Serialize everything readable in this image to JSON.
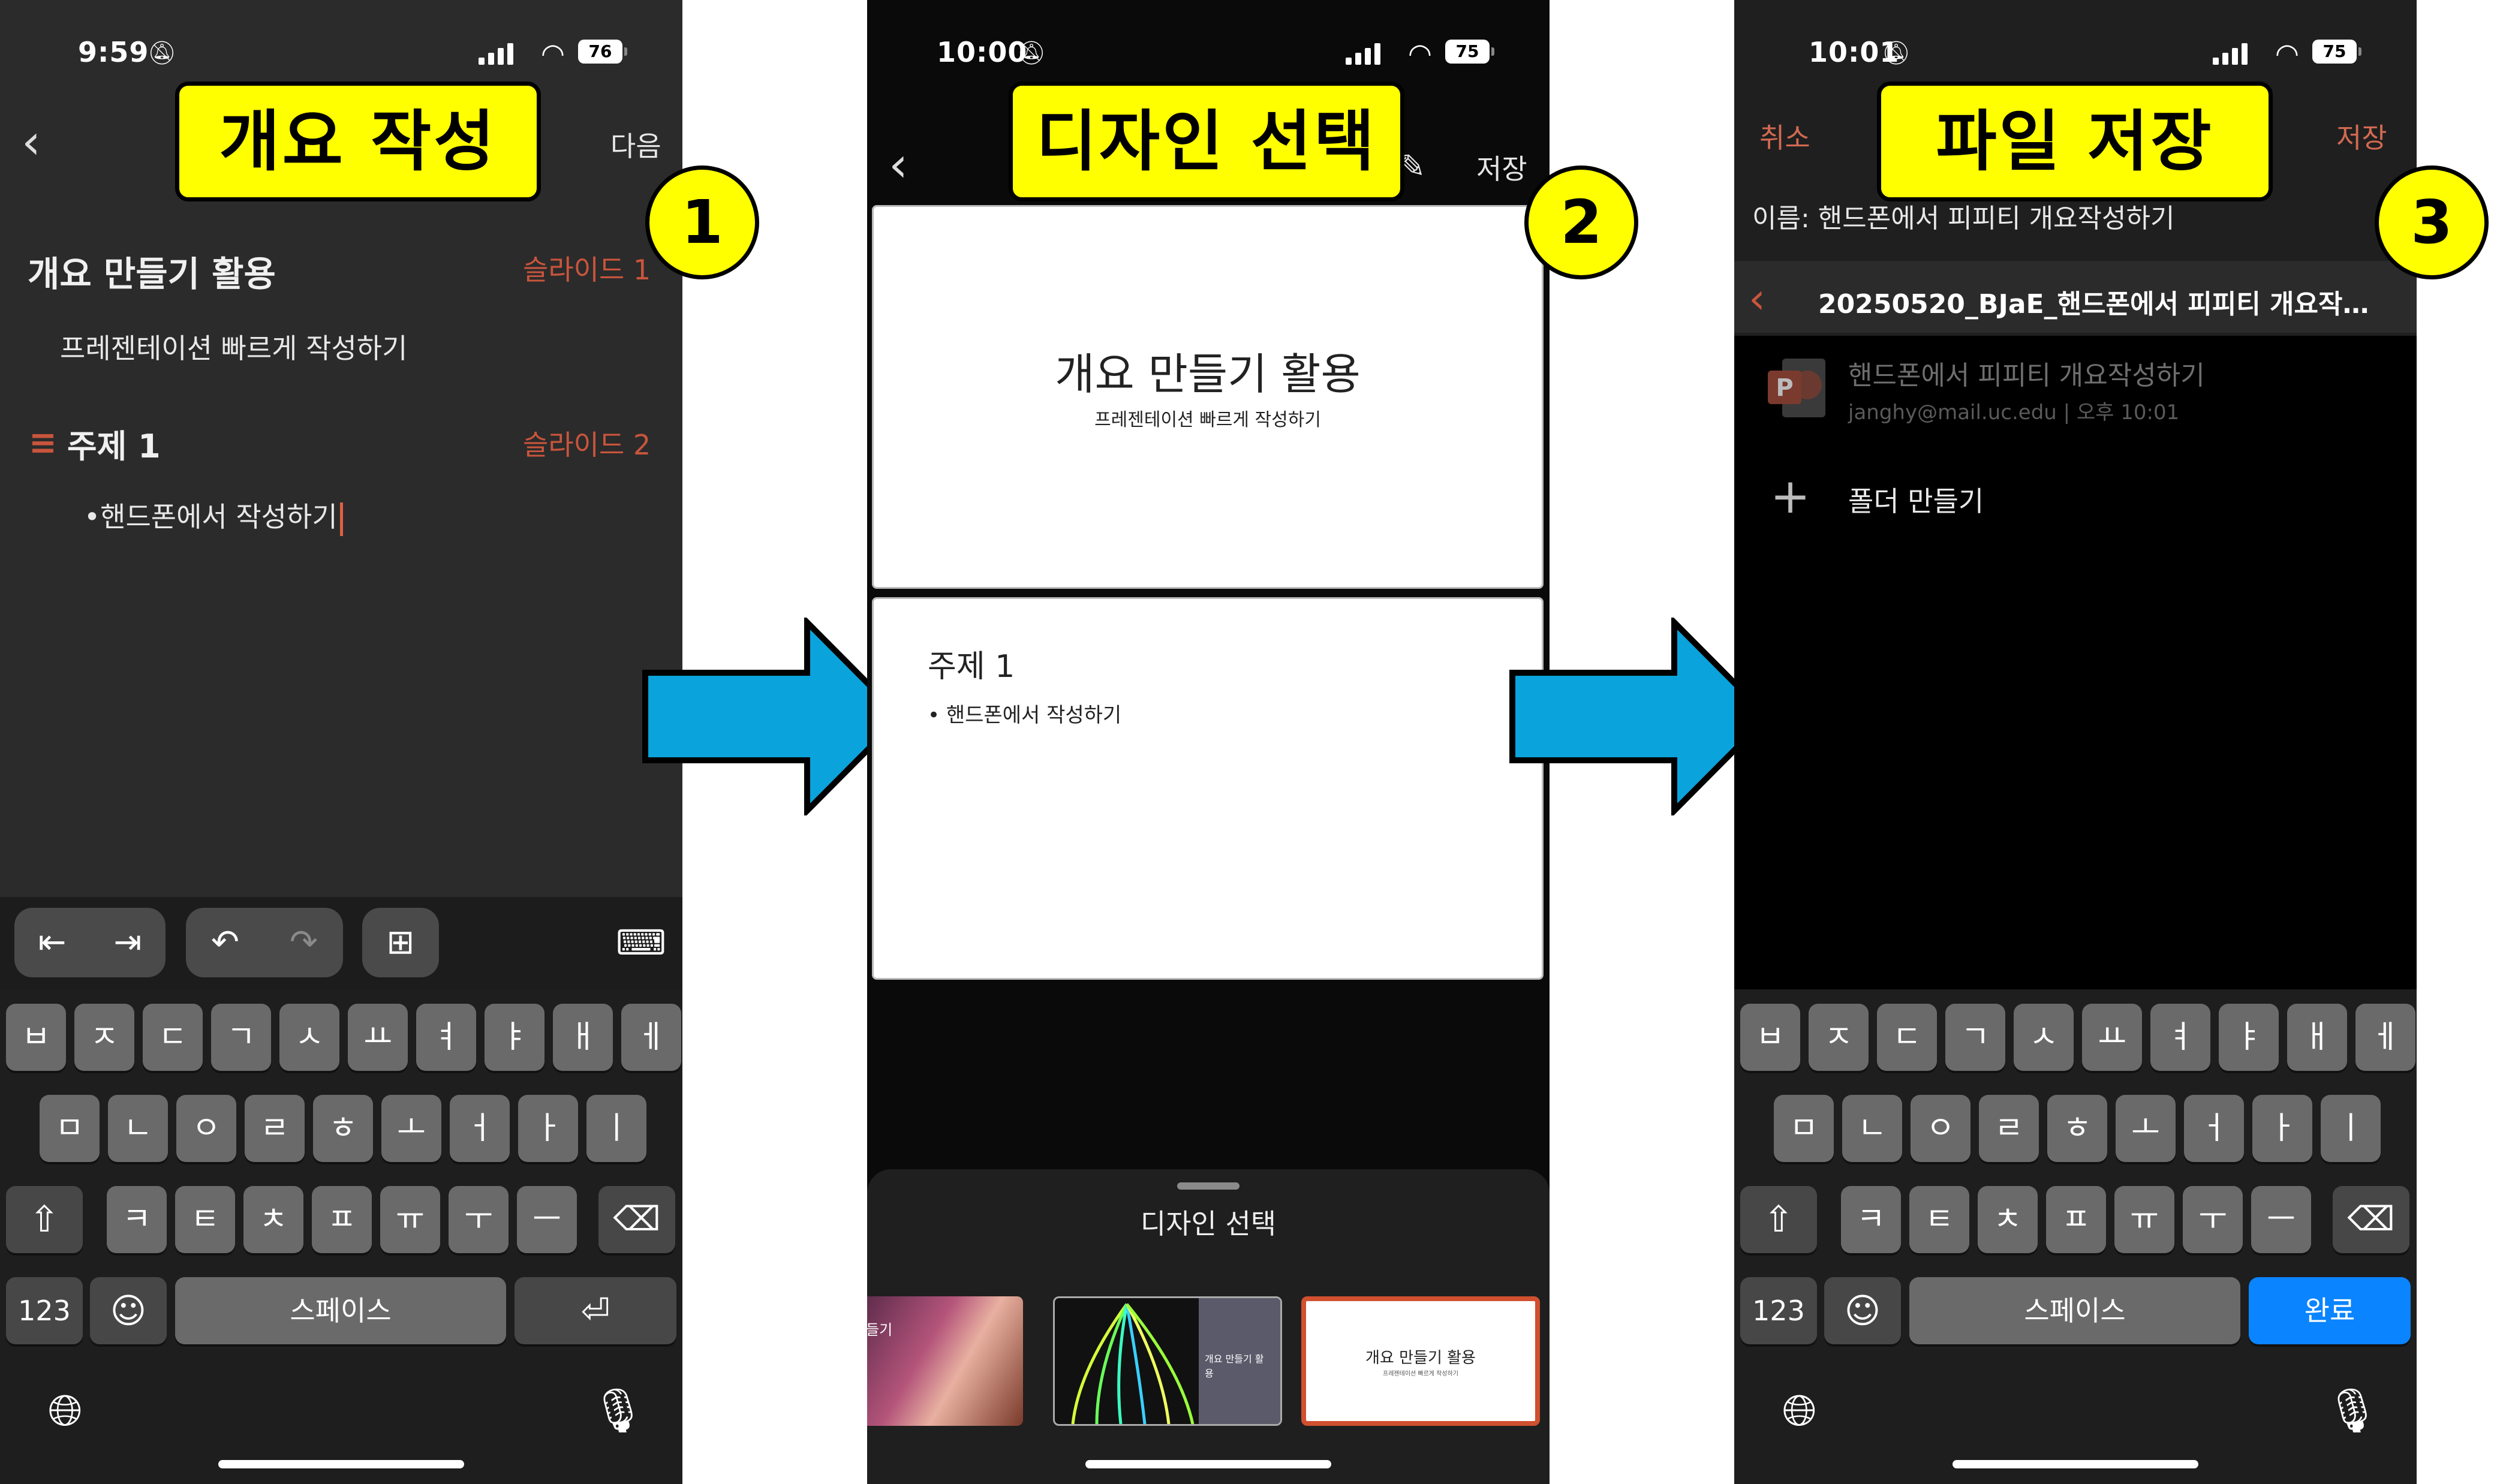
{
  "steps": [
    {
      "label": "개요 작성",
      "number": "1",
      "status": {
        "time": "9:59",
        "battery": "76"
      },
      "header": {
        "next_label": "다음"
      },
      "outline": {
        "title": "개요 만들기 활용",
        "title_tag": "슬라이드 1",
        "subtitle": "프레젠테이션 빠르게 작성하기",
        "topic": "주제 1",
        "topic_tag": "슬라이드 2",
        "bullet": "•핸드폰에서 작성하기"
      },
      "keyboard": {
        "row1": [
          "ㅂ",
          "ㅈ",
          "ㄷ",
          "ㄱ",
          "ㅅ",
          "ㅛ",
          "ㅕ",
          "ㅑ",
          "ㅐ",
          "ㅔ"
        ],
        "row2": [
          "ㅁ",
          "ㄴ",
          "ㅇ",
          "ㄹ",
          "ㅎ",
          "ㅗ",
          "ㅓ",
          "ㅏ",
          "ㅣ"
        ],
        "row3": [
          "ㅋ",
          "ㅌ",
          "ㅊ",
          "ㅍ",
          "ㅠ",
          "ㅜ",
          "ㅡ"
        ],
        "numbers": "123",
        "space": "스페이스"
      }
    },
    {
      "label": "디자인 선택",
      "number": "2",
      "status": {
        "time": "10:00",
        "battery": "75"
      },
      "header": {
        "save_label": "저장"
      },
      "slide1": {
        "title": "개요 만들기 활용",
        "subtitle": "프레젠테이션 빠르게 작성하기"
      },
      "slide2": {
        "title": "주제 1",
        "bullet": "• 핸드폰에서 작성하기"
      },
      "sheet": {
        "title": "디자인 선택",
        "thumb1_text": "들기",
        "thumb2_text": "개요 만들기 활용",
        "thumb3_title": "개요 만들기 활용",
        "thumb3_sub": "프레젠테이션 빠르게 작성하기"
      }
    },
    {
      "label": "파일 저장",
      "number": "3",
      "status": {
        "time": "10:01",
        "battery": "75"
      },
      "header": {
        "cancel_label": "취소",
        "save_label": "저장"
      },
      "name_row": "이름:  핸드폰에서 피피티 개요작성하기",
      "path": "20250520_BJaE_핸드폰에서 피피티 개요작…",
      "file": {
        "name": "핸드폰에서 피피티 개요작성하기",
        "meta": "janghy@mail.uc.edu | 오후 10:01"
      },
      "new_folder": "폴더 만들기",
      "keyboard": {
        "numbers": "123",
        "space": "스페이스",
        "done": "완료"
      }
    }
  ],
  "colors": {
    "callout": "#ffff00",
    "accent": "#c9553c",
    "arrow": "#0aa3dc",
    "done_key": "#0a84ff"
  },
  "icons": [
    "back-chevron-icon",
    "bell-mute-icon",
    "wifi-icon",
    "outdent-icon",
    "indent-icon",
    "undo-icon",
    "redo-icon",
    "add-icon",
    "keyboard-hide-icon",
    "shift-icon",
    "backspace-icon",
    "return-icon",
    "emoji-icon",
    "globe-icon",
    "microphone-icon",
    "pen-icon",
    "powerpoint-file-icon",
    "plus-icon"
  ]
}
